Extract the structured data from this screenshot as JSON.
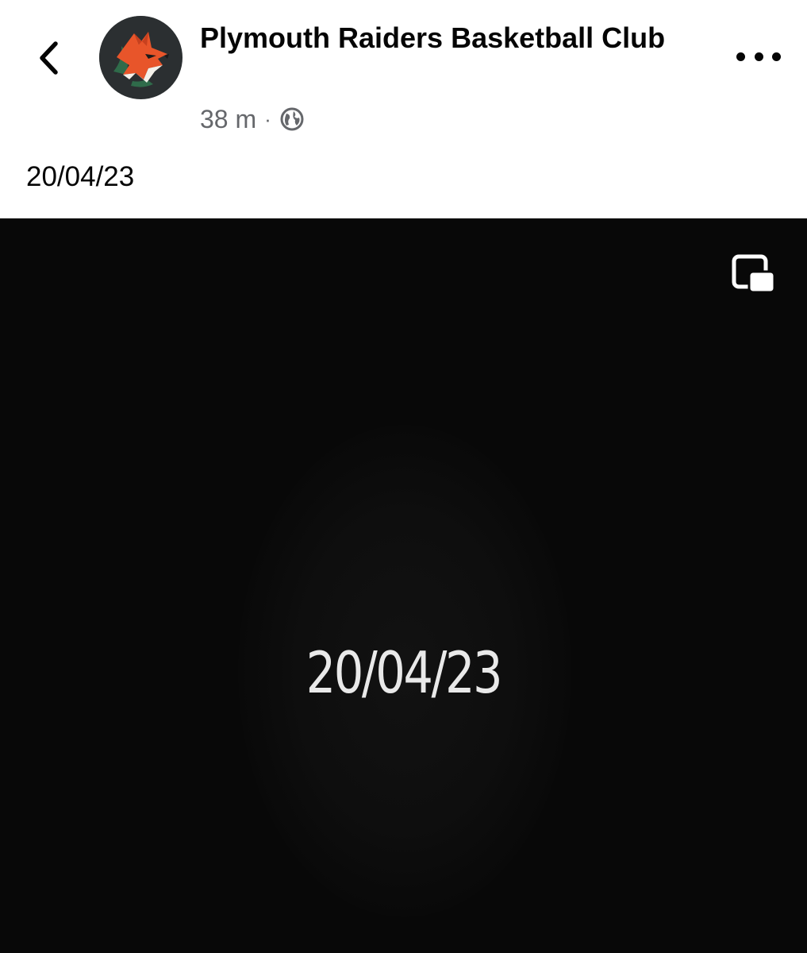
{
  "post": {
    "page_name": "Plymouth Raiders Basketball Club",
    "time_ago": "38 m",
    "separator": "·",
    "audience_icon": "globe-icon",
    "caption": "20/04/23"
  },
  "media": {
    "overlay_text": "20/04/23",
    "action_icon": "picture-in-picture-icon"
  },
  "icons": {
    "back": "chevron-left-icon",
    "more": "more-horizontal-icon",
    "avatar_logo": "fox-logo"
  },
  "colors": {
    "avatar_bg": "#2b2f31",
    "fox_orange": "#e8552a",
    "secondary_text": "#65676b",
    "media_bg": "#080808"
  }
}
